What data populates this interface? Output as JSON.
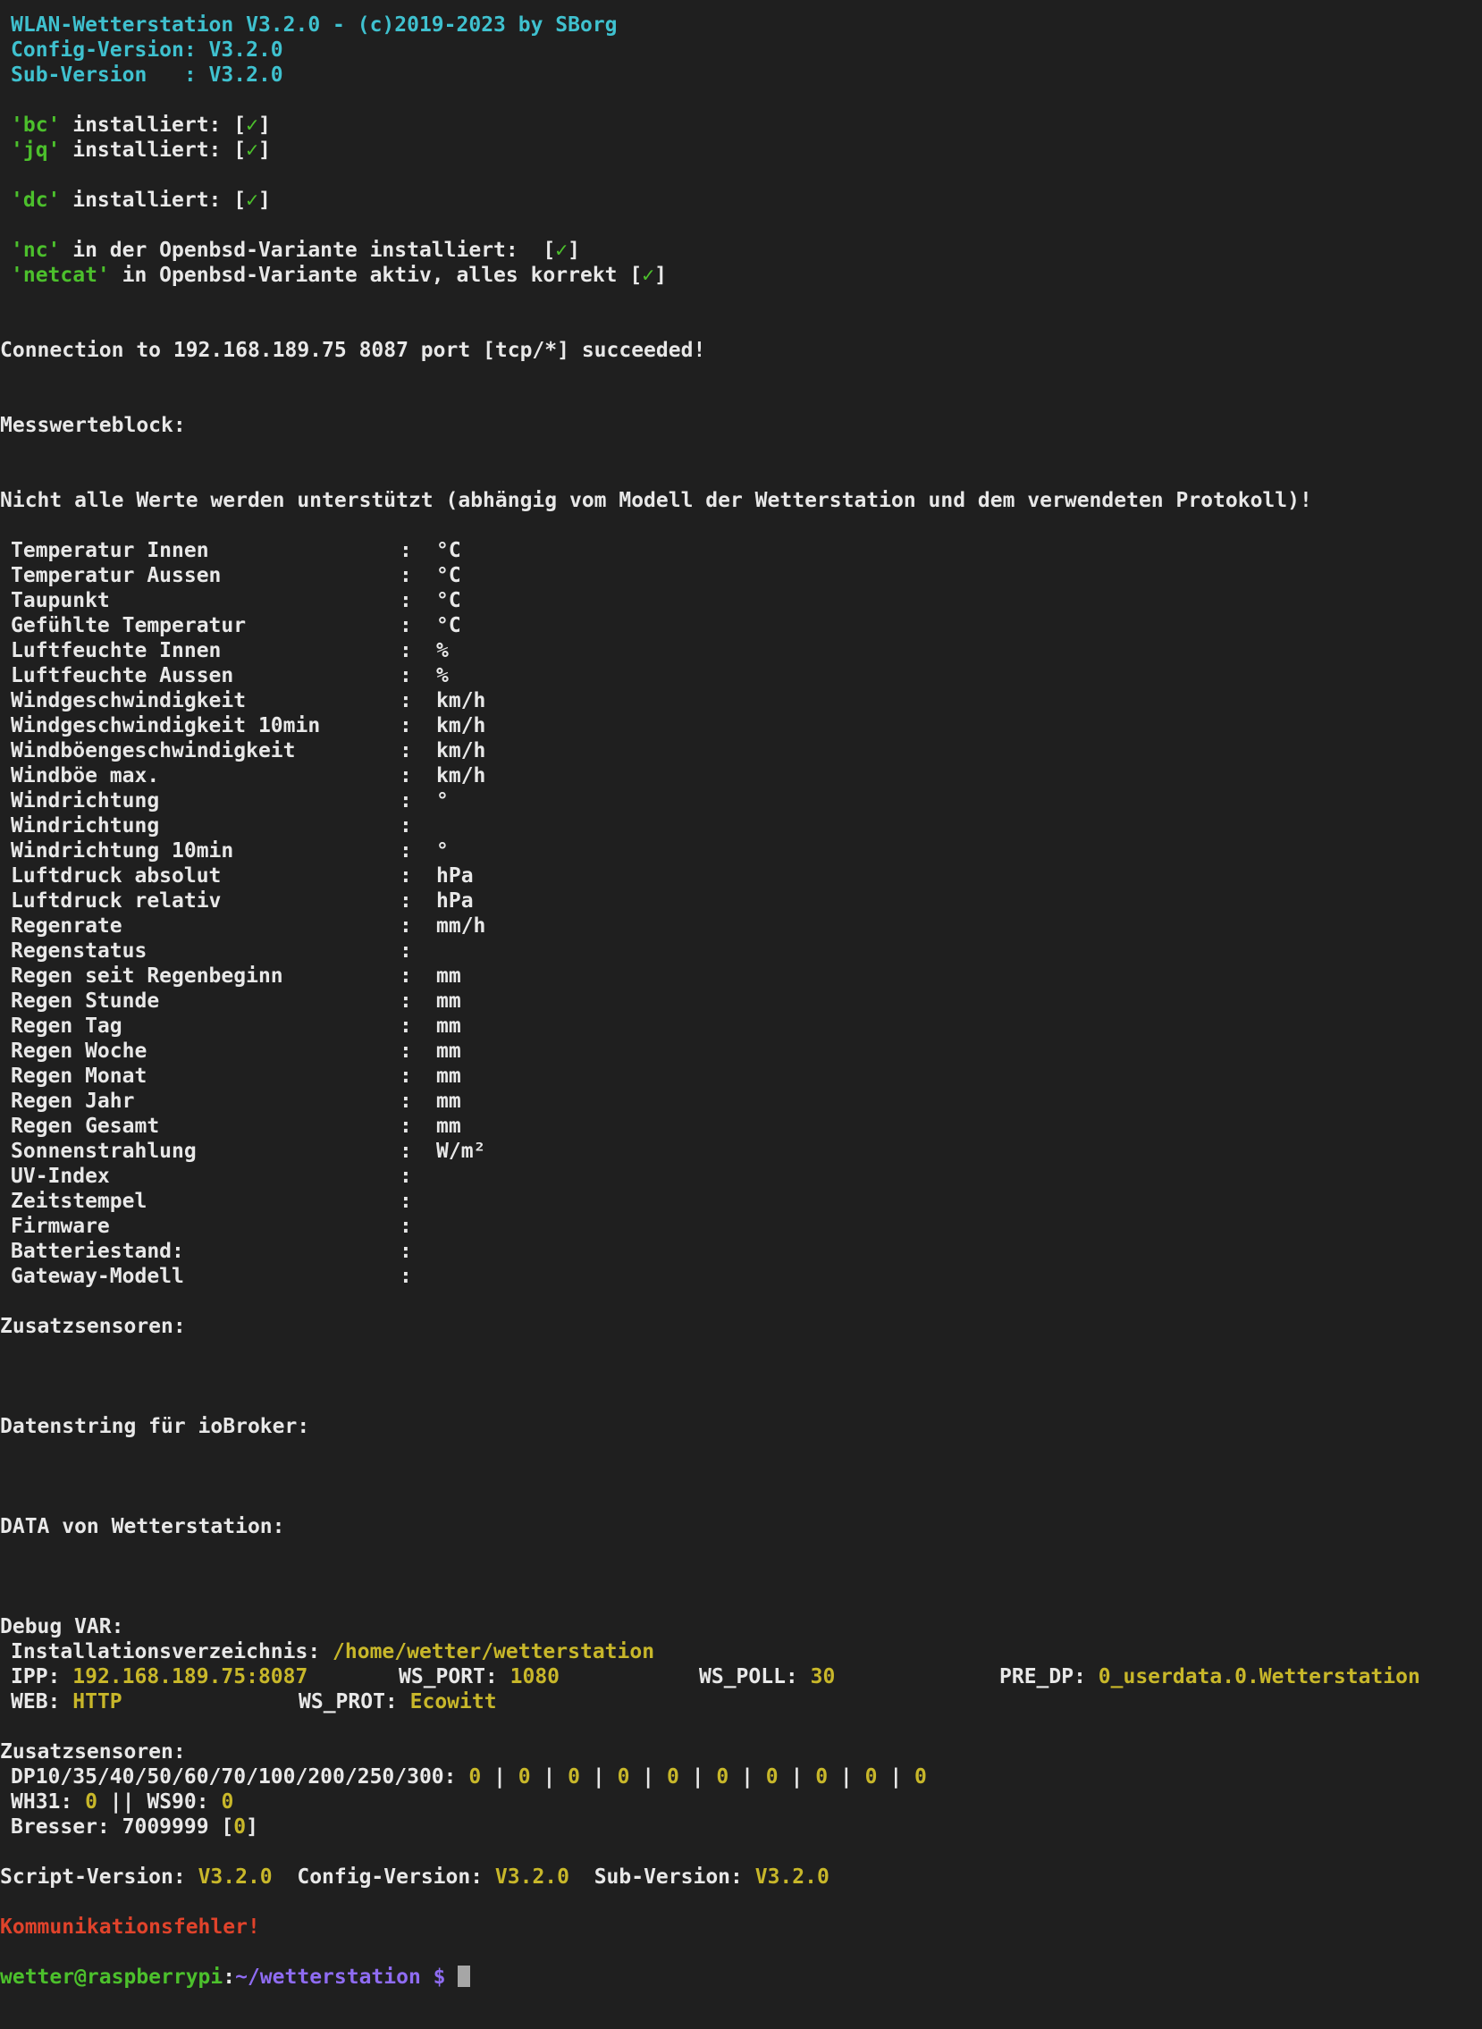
{
  "header": {
    "title": "WLAN-Wetterstation V3.2.0 - (c)2019-2023 by SBorg",
    "config_version": "Config-Version: V3.2.0",
    "sub_version": "Sub-Version   : V3.2.0"
  },
  "checks": {
    "bc": {
      "name": "'bc'",
      "text": " installiert: [",
      "mark": "✓",
      "end": "]"
    },
    "jq": {
      "name": "'jq'",
      "text": " installiert: [",
      "mark": "✓",
      "end": "]"
    },
    "dc": {
      "name": "'dc'",
      "text": " installiert: [",
      "mark": "✓",
      "end": "]"
    },
    "nc": {
      "name": "'nc'",
      "text": " in der Openbsd-Variante installiert:  [",
      "mark": "✓",
      "end": "]"
    },
    "netcat": {
      "name": "'netcat'",
      "text": " in Openbsd-Variante aktiv, alles korrekt [",
      "mark": "✓",
      "end": "]"
    }
  },
  "connection": "Connection to 192.168.189.75 8087 port [tcp/*] succeeded!",
  "messwerte_heading": "Messwerteblock:",
  "notice": "Nicht alle Werte werden unterstützt (abhängig vom Modell der Wetterstation und dem verwendeten Protokoll)!",
  "measurements": [
    {
      "label": "Temperatur Innen",
      "unit": "°C"
    },
    {
      "label": "Temperatur Aussen",
      "unit": "°C"
    },
    {
      "label": "Taupunkt",
      "unit": "°C"
    },
    {
      "label": "Gefühlte Temperatur",
      "unit": "°C"
    },
    {
      "label": "Luftfeuchte Innen",
      "unit": "%"
    },
    {
      "label": "Luftfeuchte Aussen",
      "unit": "%"
    },
    {
      "label": "Windgeschwindigkeit",
      "unit": "km/h"
    },
    {
      "label": "Windgeschwindigkeit 10min",
      "unit": "km/h"
    },
    {
      "label": "Windböengeschwindigkeit",
      "unit": "km/h"
    },
    {
      "label": "Windböe max.",
      "unit": "km/h"
    },
    {
      "label": "Windrichtung",
      "unit": "°"
    },
    {
      "label": "Windrichtung",
      "unit": ""
    },
    {
      "label": "Windrichtung 10min",
      "unit": "°"
    },
    {
      "label": "Luftdruck absolut",
      "unit": "hPa"
    },
    {
      "label": "Luftdruck relativ",
      "unit": "hPa"
    },
    {
      "label": "Regenrate",
      "unit": "mm/h"
    },
    {
      "label": "Regenstatus",
      "unit": ""
    },
    {
      "label": "Regen seit Regenbeginn",
      "unit": "mm"
    },
    {
      "label": "Regen Stunde",
      "unit": "mm"
    },
    {
      "label": "Regen Tag",
      "unit": "mm"
    },
    {
      "label": "Regen Woche",
      "unit": "mm"
    },
    {
      "label": "Regen Monat",
      "unit": "mm"
    },
    {
      "label": "Regen Jahr",
      "unit": "mm"
    },
    {
      "label": "Regen Gesamt",
      "unit": "mm"
    },
    {
      "label": "Sonnenstrahlung",
      "unit": "W/m²"
    },
    {
      "label": "UV-Index",
      "unit": ""
    },
    {
      "label": "Zeitstempel",
      "unit": ""
    },
    {
      "label": "Firmware",
      "unit": ""
    },
    {
      "label": "Batteriestand:",
      "unit": ""
    },
    {
      "label": "Gateway-Modell",
      "unit": ""
    }
  ],
  "colon": ":",
  "zusatz_heading": "Zusatzsensoren:",
  "iobroker_heading": "Datenstring für ioBroker:",
  "data_heading": "DATA von Wetterstation:",
  "debug": {
    "heading": "Debug VAR:",
    "install_label": "Installationsverzeichnis: ",
    "install_value": "/home/wetter/wetterstation",
    "ipp_label": "IPP: ",
    "ipp_value": "192.168.189.75:8087",
    "ws_port_label": "WS_PORT: ",
    "ws_port_value": "1080",
    "ws_poll_label": "WS_POLL: ",
    "ws_poll_value": "30",
    "pre_dp_label": "PRE_DP: ",
    "pre_dp_value": "0_userdata.0.Wetterstation",
    "web_label": "WEB: ",
    "web_value": "HTTP",
    "ws_prot_label": "WS_PROT: ",
    "ws_prot_value": "Ecowitt",
    "zusatz_heading": "Zusatzsensoren:",
    "dp_label": "DP10/35/40/50/60/70/100/200/250/300: ",
    "dp_values": [
      "0",
      "0",
      "0",
      "0",
      "0",
      "0",
      "0",
      "0",
      "0",
      "0"
    ],
    "dp_sep": " | ",
    "wh31_label": "WH31: ",
    "wh31_value": "0",
    "ws90_label": " || WS90: ",
    "ws90_value": "0",
    "bresser_label": "Bresser: 7009999 [",
    "bresser_value": "0",
    "bresser_end": "]"
  },
  "versions": {
    "script_label": "Script-Version: ",
    "script_value": "V3.2.0",
    "config_label": "  Config-Version: ",
    "config_value": "V3.2.0",
    "sub_label": "  Sub-Version: ",
    "sub_value": "V3.2.0"
  },
  "error": "Kommunikationsfehler!",
  "prompt": {
    "user_host": "wetter@raspberrypi",
    "sep": ":",
    "path": "~/wetterstation $ "
  },
  "colors": {
    "background": "#1f1f1f",
    "cyan": "#3fc1cf",
    "green": "#4cc02c",
    "yellow": "#c8b72a",
    "red": "#e0432b",
    "purple": "#8f6cf2"
  }
}
